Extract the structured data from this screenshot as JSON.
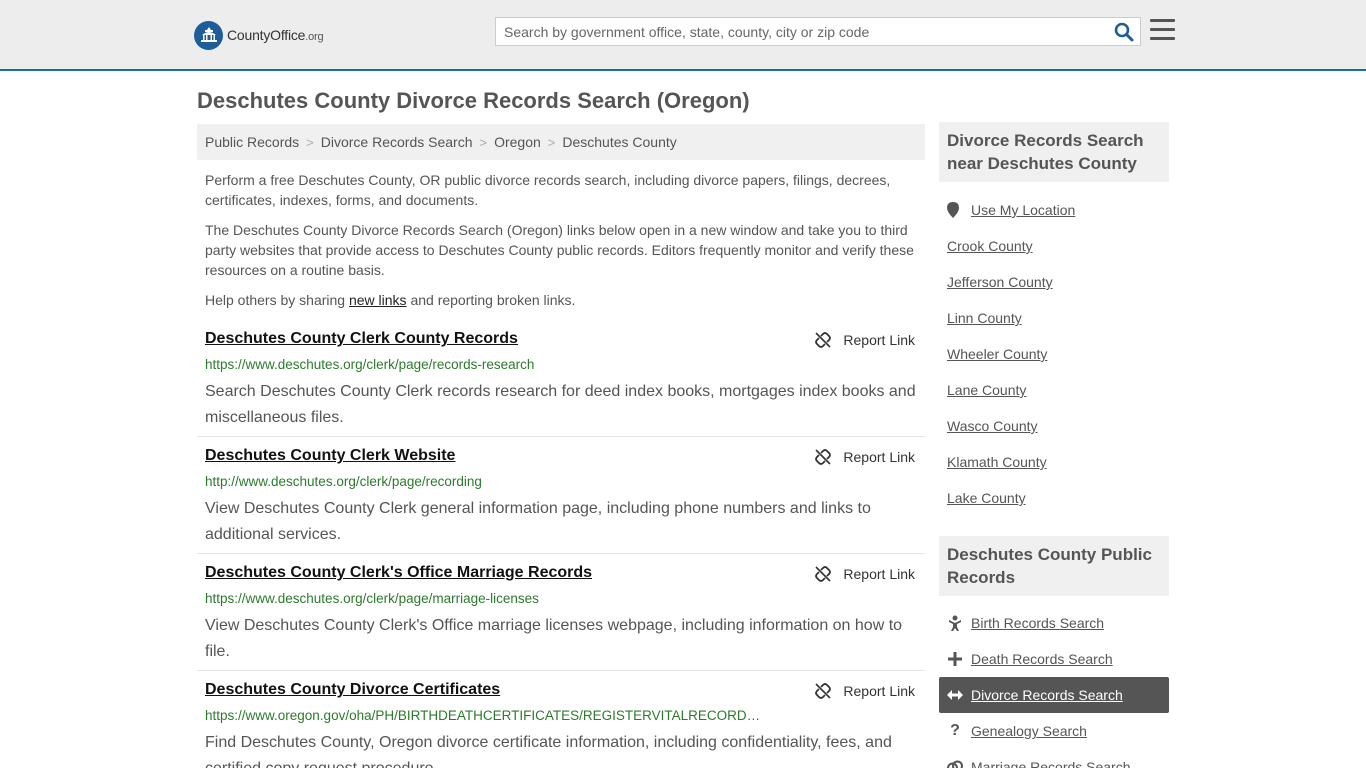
{
  "header": {
    "logo_main": "CountyOffice",
    "logo_suffix": ".org",
    "search_placeholder": "Search by government office, state, county, city or zip code",
    "icons": {
      "search": "search-icon",
      "menu": "hamburger-menu-icon",
      "logo": "capitol-seal-icon"
    },
    "colors": {
      "header_bg": "#ededed",
      "accent": "#1c6aa5",
      "logo_blue": "#1d5d99"
    }
  },
  "page": {
    "title": "Deschutes County Divorce Records Search (Oregon)"
  },
  "breadcrumb": [
    {
      "label": "Public Records"
    },
    {
      "label": "Divorce Records Search"
    },
    {
      "label": "Oregon"
    },
    {
      "label": "Deschutes County"
    }
  ],
  "intro": {
    "p1": "Perform a free Deschutes County, OR public divorce records search, including divorce papers, filings, decrees, certificates, indexes, forms, and documents.",
    "p2": "The Deschutes County Divorce Records Search (Oregon) links below open in a new window and take you to third party websites that provide access to Deschutes County public records. Editors frequently monitor and verify these resources on a routine basis.",
    "p3_before": "Help others by sharing ",
    "p3_link": "new links",
    "p3_after": " and reporting broken links."
  },
  "results": [
    {
      "title": "Deschutes County Clerk County Records",
      "url": "https://www.deschutes.org/clerk/page/records-research",
      "description": "Search Deschutes County Clerk records research for deed index books, mortgages index books and miscellaneous files.",
      "report_label": "Report Link"
    },
    {
      "title": "Deschutes County Clerk Website",
      "url": "http://www.deschutes.org/clerk/page/recording",
      "description": "View Deschutes County Clerk general information page, including phone numbers and links to additional services.",
      "report_label": "Report Link"
    },
    {
      "title": "Deschutes County Clerk's Office Marriage Records",
      "url": "https://www.deschutes.org/clerk/page/marriage-licenses",
      "description": "View Deschutes County Clerk's Office marriage licenses webpage, including information on how to file.",
      "report_label": "Report Link"
    },
    {
      "title": "Deschutes County Divorce Certificates",
      "url": "https://www.oregon.gov/oha/PH/BIRTHDEATHCERTIFICATES/REGISTERVITALRECORD…",
      "description": "Find Deschutes County, Oregon divorce certificate information, including confidentiality, fees, and certified copy request procedure.",
      "report_label": "Report Link"
    }
  ],
  "sidebar": {
    "nearby_heading": "Divorce Records Search near Deschutes County",
    "use_location": "Use My Location",
    "nearby": [
      "Crook County",
      "Jefferson County",
      "Linn County",
      "Wheeler County",
      "Lane County",
      "Wasco County",
      "Klamath County",
      "Lake County"
    ],
    "public_records_heading": "Deschutes County Public Records",
    "public_records": [
      {
        "label": "Birth Records Search",
        "icon": "baby-icon",
        "active": false
      },
      {
        "label": "Death Records Search",
        "icon": "cross-icon",
        "active": false
      },
      {
        "label": "Divorce Records Search",
        "icon": "split-arrows-icon",
        "active": true
      },
      {
        "label": "Genealogy Search",
        "icon": "question-icon",
        "active": false
      },
      {
        "label": "Marriage Records Search",
        "icon": "rings-icon",
        "active": false
      }
    ]
  }
}
